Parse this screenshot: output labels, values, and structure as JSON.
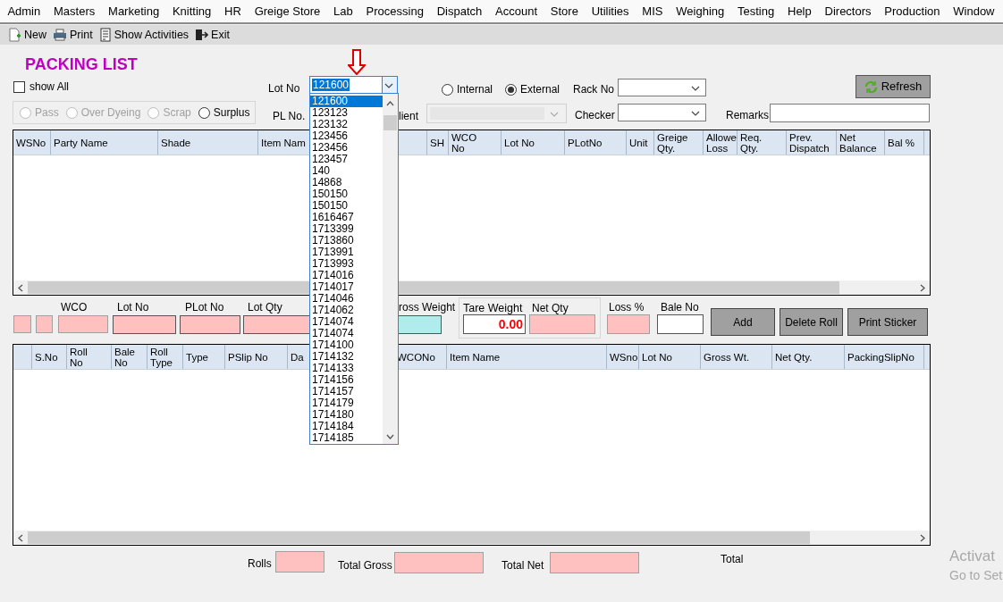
{
  "menu": [
    "Admin",
    "Masters",
    "Marketing",
    "Knitting",
    "HR",
    "Greige Store",
    "Lab",
    "Processing",
    "Dispatch",
    "Account",
    "Store",
    "Utilities",
    "MIS",
    "Weighing",
    "Testing",
    "Help",
    "Directors",
    "Production",
    "Window"
  ],
  "toolbar": [
    {
      "label": "New",
      "kind": "new"
    },
    {
      "label": "Print",
      "kind": "print"
    },
    {
      "label": "Show Activities",
      "kind": "activities"
    },
    {
      "label": "Exit",
      "kind": "exit"
    }
  ],
  "title": "PACKING LIST",
  "show_all": {
    "label": "show All",
    "checked": false
  },
  "lot_no": {
    "label": "Lot No",
    "value": "121600"
  },
  "source": [
    {
      "label": "Internal",
      "selected": false
    },
    {
      "label": "External",
      "selected": true
    }
  ],
  "rack_no": {
    "label": "Rack No"
  },
  "refresh": "Refresh",
  "status_options": [
    {
      "label": "Pass",
      "selected": false,
      "disabled": true
    },
    {
      "label": "Over Dyeing",
      "selected": false,
      "disabled": true
    },
    {
      "label": "Scrap",
      "selected": false,
      "disabled": true
    },
    {
      "label": "Surplus",
      "selected": false,
      "disabled": false
    }
  ],
  "pl_no": {
    "label": "PL No."
  },
  "client": {
    "label": "lient",
    "disabled": true
  },
  "checker": {
    "label": "Checker"
  },
  "remarks": {
    "label": "Remarks"
  },
  "grid1": {
    "columns": [
      "WSNo",
      "Party Name",
      "Shade",
      "Item Nam",
      "SH",
      "WCO\nNo",
      "Lot No",
      "PLotNo",
      "Unit",
      "Greige\nQty.",
      "Allowe\nLoss",
      "Req.\nQty.",
      "Prev.\nDispatch",
      "Net\nBalance",
      "Bal %"
    ]
  },
  "entry": {
    "labels": [
      "WCO",
      "Lot No",
      "PLot No",
      "Lot Qty",
      "ross Weight"
    ],
    "tare_weight": {
      "label": "Tare Weight",
      "value": "0.00"
    },
    "net_qty": {
      "label": "Net Qty"
    },
    "loss": {
      "label": "Loss %"
    },
    "bale_no": {
      "label": "Bale No"
    }
  },
  "buttons": [
    "Add",
    "Delete Roll",
    "Print Sticker"
  ],
  "grid2": {
    "columns": [
      "",
      "S.No",
      "Roll\nNo",
      "Bale\nNo",
      "Roll\nType",
      "Type",
      "PSlip No",
      "Da",
      "WCONo",
      "Item Name",
      "WSno",
      "Lot No",
      "Gross Wt.",
      "Net Qty.",
      "PackingSlipNo"
    ]
  },
  "totals": {
    "rolls": "Rolls",
    "total_gross": "Total Gross",
    "total_net": "Total Net",
    "total": "Total"
  },
  "lot_dropdown": [
    {
      "label": "121600",
      "selected": true
    },
    {
      "label": "123123",
      "selected": false
    },
    {
      "label": "123132",
      "selected": false
    },
    {
      "label": "123456",
      "selected": false
    },
    {
      "label": "123456",
      "selected": false
    },
    {
      "label": "123457",
      "selected": false
    },
    {
      "label": "140",
      "selected": false
    },
    {
      "label": "14868",
      "selected": false
    },
    {
      "label": "150150",
      "selected": false
    },
    {
      "label": "150150",
      "selected": false
    },
    {
      "label": "1616467",
      "selected": false
    },
    {
      "label": "1713399",
      "selected": false
    },
    {
      "label": "1713860",
      "selected": false
    },
    {
      "label": "1713991",
      "selected": false
    },
    {
      "label": "1713993",
      "selected": false
    },
    {
      "label": "1714016",
      "selected": false
    },
    {
      "label": "1714017",
      "selected": false
    },
    {
      "label": "1714046",
      "selected": false
    },
    {
      "label": "1714062",
      "selected": false
    },
    {
      "label": "1714074",
      "selected": false
    },
    {
      "label": "1714074",
      "selected": false
    },
    {
      "label": "1714100",
      "selected": false
    },
    {
      "label": "1714132",
      "selected": false
    },
    {
      "label": "1714133",
      "selected": false
    },
    {
      "label": "1714156",
      "selected": false
    },
    {
      "label": "1714157",
      "selected": false
    },
    {
      "label": "1714179",
      "selected": false
    },
    {
      "label": "1714180",
      "selected": false
    },
    {
      "label": "1714184",
      "selected": false
    },
    {
      "label": "1714185",
      "selected": false
    }
  ],
  "activation": [
    "Activat",
    "Go to Set"
  ]
}
